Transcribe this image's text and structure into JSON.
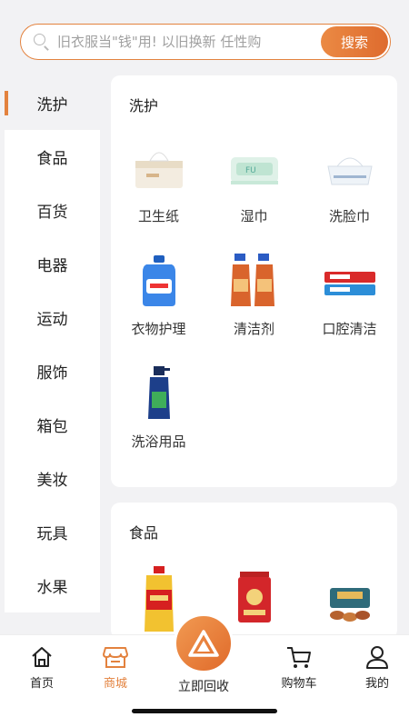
{
  "search": {
    "placeholder": "旧衣服当\"钱\"用! 以旧换新 任性购",
    "button_label": "搜索"
  },
  "sidebar": {
    "items": [
      {
        "label": "洗护",
        "active": true
      },
      {
        "label": "食品"
      },
      {
        "label": "百货"
      },
      {
        "label": "电器"
      },
      {
        "label": "运动"
      },
      {
        "label": "服饰"
      },
      {
        "label": "箱包"
      },
      {
        "label": "美妆"
      },
      {
        "label": "玩具"
      },
      {
        "label": "水果"
      }
    ]
  },
  "sections": [
    {
      "title": "洗护",
      "items": [
        {
          "label": "卫生纸",
          "icon": "tissue-box-icon"
        },
        {
          "label": "湿巾",
          "icon": "wet-wipes-icon"
        },
        {
          "label": "洗脸巾",
          "icon": "face-towel-icon"
        },
        {
          "label": "衣物护理",
          "icon": "detergent-bottle-icon"
        },
        {
          "label": "清洁剂",
          "icon": "spray-bottles-icon"
        },
        {
          "label": "口腔清洁",
          "icon": "toothpaste-icon"
        },
        {
          "label": "洗浴用品",
          "icon": "shampoo-bottle-icon"
        }
      ]
    },
    {
      "title": "食品",
      "items": [
        {
          "label": "",
          "icon": "cooking-oil-icon"
        },
        {
          "label": "",
          "icon": "rice-bag-icon"
        },
        {
          "label": "",
          "icon": "gift-box-icon"
        }
      ]
    }
  ],
  "bottom_nav": {
    "home": "首页",
    "mall": "商城",
    "recycle": "立即回收",
    "cart": "购物车",
    "me": "我的"
  },
  "colors": {
    "accent": "#e3823e",
    "background": "#f2f2f4"
  }
}
